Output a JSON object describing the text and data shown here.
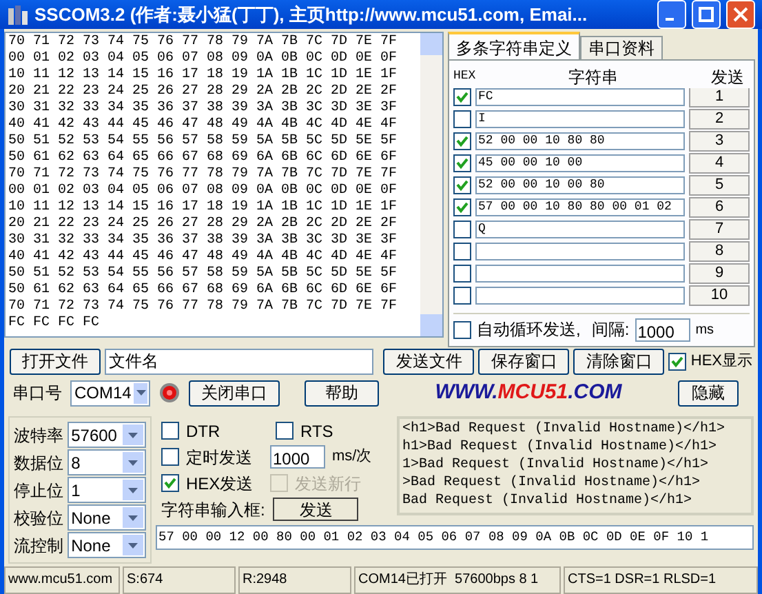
{
  "window": {
    "title": "SSCOM3.2 (作者:聂小猛(丁丁), 主页http://www.mcu51.com, Emai..."
  },
  "receive_lines": [
    "70 71 72 73 74 75 76 77 78 79 7A 7B 7C 7D 7E 7F",
    "00 01 02 03 04 05 06 07 08 09 0A 0B 0C 0D 0E 0F",
    "10 11 12 13 14 15 16 17 18 19 1A 1B 1C 1D 1E 1F",
    "20 21 22 23 24 25 26 27 28 29 2A 2B 2C 2D 2E 2F",
    "30 31 32 33 34 35 36 37 38 39 3A 3B 3C 3D 3E 3F",
    "40 41 42 43 44 45 46 47 48 49 4A 4B 4C 4D 4E 4F",
    "50 51 52 53 54 55 56 57 58 59 5A 5B 5C 5D 5E 5F",
    "50 61 62 63 64 65 66 67 68 69 6A 6B 6C 6D 6E 6F",
    "70 71 72 73 74 75 76 77 78 79 7A 7B 7C 7D 7E 7F",
    "00 01 02 03 04 05 06 07 08 09 0A 0B 0C 0D 0E 0F",
    "10 11 12 13 14 15 16 17 18 19 1A 1B 1C 1D 1E 1F",
    "20 21 22 23 24 25 26 27 28 29 2A 2B 2C 2D 2E 2F",
    "30 31 32 33 34 35 36 37 38 39 3A 3B 3C 3D 3E 3F",
    "40 41 42 43 44 45 46 47 48 49 4A 4B 4C 4D 4E 4F",
    "50 51 52 53 54 55 56 57 58 59 5A 5B 5C 5D 5E 5F",
    "50 61 62 63 64 65 66 67 68 69 6A 6B 6C 6D 6E 6F",
    "70 71 72 73 74 75 76 77 78 79 7A 7B 7C 7D 7E 7F",
    "FC FC FC FC"
  ],
  "tabs": [
    {
      "label": "多条字符串定义",
      "selected": true
    },
    {
      "label": "串口资料",
      "selected": false
    }
  ],
  "string_table": {
    "columns": [
      "HEX",
      "字符串",
      "发送"
    ],
    "rows": [
      {
        "hex": true,
        "value": "FC",
        "button": "1"
      },
      {
        "hex": false,
        "value": "I",
        "button": "2"
      },
      {
        "hex": true,
        "value": "52 00 00 10 80 80",
        "button": "3"
      },
      {
        "hex": true,
        "value": "45 00 00 10 00",
        "button": "4"
      },
      {
        "hex": true,
        "value": "52 00 00 10 00 80",
        "button": "5"
      },
      {
        "hex": true,
        "value": "57 00 00 10 80 80 00 01 02",
        "button": "6"
      },
      {
        "hex": false,
        "value": "Q",
        "button": "7"
      },
      {
        "hex": false,
        "value": "",
        "button": "8"
      },
      {
        "hex": false,
        "value": "",
        "button": "9"
      },
      {
        "hex": false,
        "value": "",
        "button": "10"
      }
    ]
  },
  "auto_loop": {
    "label": "自动循环发送,",
    "checked": false,
    "interval_label": "间隔:",
    "interval": "1000",
    "unit": "ms"
  },
  "file_row": {
    "open_button": "打开文件",
    "filename": "文件名",
    "send_file": "发送文件",
    "save_window": "保存窗口",
    "clear_window": "清除窗口",
    "hex_display": {
      "label": "HEX显示",
      "checked": true
    }
  },
  "port_row": {
    "label": "串口号",
    "port": "COM14",
    "open": true,
    "close_button": "关闭串口",
    "help_button": "帮助",
    "logo_a": "WWW.",
    "logo_b": "MCU51",
    "logo_c": ".COM",
    "hide_button": "隐藏"
  },
  "settings": [
    {
      "label": "波特率",
      "value": "57600"
    },
    {
      "label": "数据位",
      "value": "8"
    },
    {
      "label": "停止位",
      "value": "1"
    },
    {
      "label": "校验位",
      "value": "None"
    },
    {
      "label": "流控制",
      "value": "None"
    }
  ],
  "options": {
    "dtr": {
      "label": "DTR",
      "checked": false
    },
    "rts": {
      "label": "RTS",
      "checked": false
    },
    "timed": {
      "label": "定时发送",
      "checked": false
    },
    "period": "1000",
    "period_unit": "ms/次",
    "hex_send": {
      "label": "HEX发送",
      "checked": true
    },
    "newline": {
      "label": "发送新行",
      "checked": false,
      "disabled": true
    },
    "input_label": "字符串输入框:",
    "send_button": "发送"
  },
  "response_lines": [
    "<h1>Bad Request (Invalid Hostname)</h1>",
    "h1>Bad Request (Invalid Hostname)</h1>",
    "1>Bad Request (Invalid Hostname)</h1>",
    ">Bad Request (Invalid Hostname)</h1>",
    "Bad Request (Invalid Hostname)</h1>"
  ],
  "send_input": "57 00 00 12 00 80 00 01 02 03 04 05 06 07 08 09 0A 0B 0C 0D 0E 0F 10 1",
  "status_bar": [
    "www.mcu51.com",
    "S:674",
    "R:2948",
    "COM14已打开  57600bps 8 1",
    "CTS=1 DSR=1 RLSD=1"
  ]
}
